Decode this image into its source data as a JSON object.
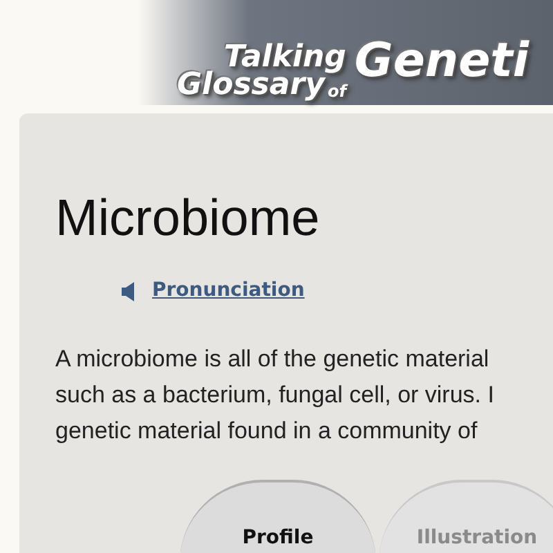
{
  "logo": {
    "words": [
      {
        "text": "Talking",
        "kind": "small"
      },
      {
        "text": "Glossary",
        "kind": "small"
      },
      {
        "text": "of",
        "kind": "tiny"
      },
      {
        "text": "Geneti",
        "kind": "large"
      }
    ]
  },
  "term": {
    "title": "Microbiome",
    "pronunciation": "Pronunciation",
    "definition_lines": [
      "A microbiome is all of the genetic material",
      "such as a bacterium, fungal cell, or virus. I",
      "genetic material found in a community of"
    ]
  },
  "tabs": [
    {
      "label": "Profile",
      "selected": true
    },
    {
      "label": "Illustration",
      "selected": false
    }
  ]
}
